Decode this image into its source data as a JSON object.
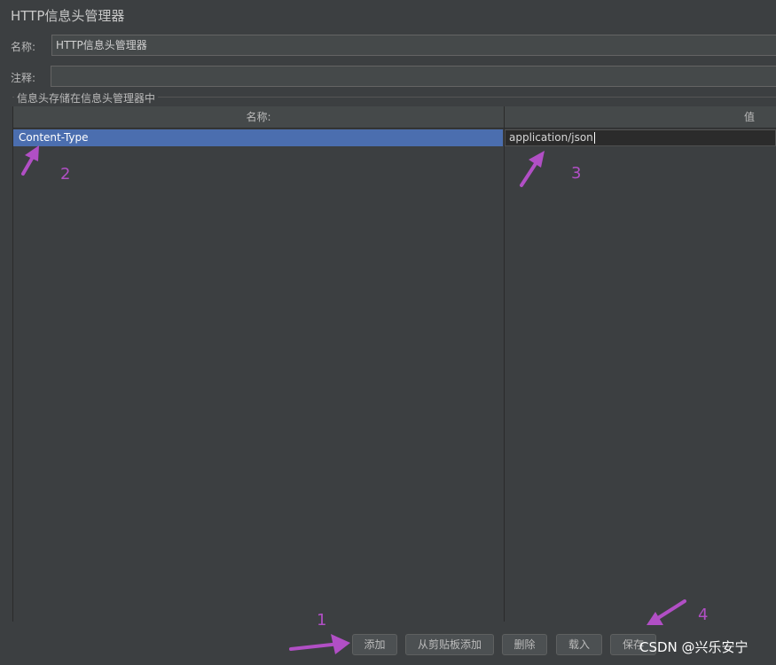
{
  "panel": {
    "title": "HTTP信息头管理器"
  },
  "fields": {
    "name_label": "名称:",
    "name_value": "HTTP信息头管理器",
    "comment_label": "注释:",
    "comment_value": ""
  },
  "headers_group": {
    "title": "信息头存储在信息头管理器中",
    "columns": [
      "名称:",
      "值"
    ],
    "rows": [
      {
        "name": "Content-Type",
        "value": "application/json"
      }
    ]
  },
  "buttons": {
    "add": "添加",
    "add_from_clipboard": "从剪贴板添加",
    "delete": "删除",
    "load": "载入",
    "save": "保存"
  },
  "annotations": {
    "markers": [
      "1",
      "2",
      "3",
      "4"
    ],
    "arrow_color": "#b14fc5"
  },
  "watermark": "CSDN @兴乐安宁",
  "colors": {
    "background": "#3c3f41",
    "selection": "#4b6eaf",
    "editor": "#2b2b2b"
  }
}
